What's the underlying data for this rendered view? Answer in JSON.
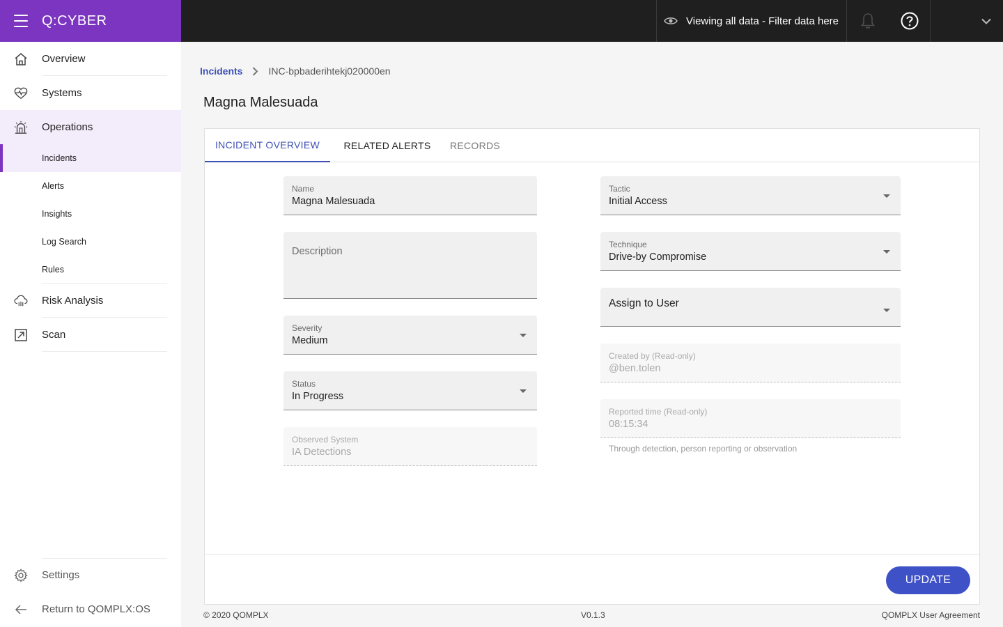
{
  "brand": {
    "logo_text": "Q:CYBER",
    "color": "#7b35c1"
  },
  "topbar": {
    "filter_label": "Viewing all data - Filter data here",
    "icons": [
      "eye-icon",
      "bell-icon",
      "help-icon",
      "chevron-down-icon"
    ]
  },
  "sidebar": {
    "items": [
      {
        "label": "Overview",
        "icon": "home-icon"
      },
      {
        "label": "Systems",
        "icon": "heart-pulse-icon"
      },
      {
        "label": "Operations",
        "icon": "alarm-icon"
      },
      {
        "label": "Risk Analysis",
        "icon": "cloud-icon"
      },
      {
        "label": "Scan",
        "icon": "external-link-icon"
      }
    ],
    "sub_items": [
      "Incidents",
      "Alerts",
      "Insights",
      "Log Search",
      "Rules"
    ],
    "active_sub": "Incidents",
    "settings_label": "Settings",
    "return_label": "Return to QOMPLX:OS"
  },
  "breadcrumb": {
    "parent": "Incidents",
    "current": "INC-bpbaderihtekj020000en"
  },
  "page": {
    "title": "Magna Malesuada"
  },
  "tabs": [
    "INCIDENT OVERVIEW",
    "RELATED ALERTS",
    "RECORDS"
  ],
  "form": {
    "name": {
      "label": "Name",
      "value": "Magna Malesuada"
    },
    "description": {
      "placeholder": "Description"
    },
    "severity": {
      "label": "Severity",
      "value": "Medium"
    },
    "status": {
      "label": "Status",
      "value": "In Progress"
    },
    "observed_system": {
      "label": "Observed System",
      "value": "IA Detections"
    },
    "tactic": {
      "label": "Tactic",
      "value": "Initial Access"
    },
    "technique": {
      "label": "Technique",
      "value": "Drive-by Compromise"
    },
    "assign": {
      "label": "Assign to User"
    },
    "created_by": {
      "label": "Created by (Read-only)",
      "value": "@ben.tolen"
    },
    "reported_time": {
      "label": "Reported time (Read-only)",
      "value": "08:15:34",
      "helper": "Through detection, person reporting or observation"
    }
  },
  "actions": {
    "update_label": "UPDATE"
  },
  "footer": {
    "copyright": "© 2020 QOMPLX",
    "version": "V0.1.3",
    "agreement": "QOMPLX User Agreement"
  }
}
